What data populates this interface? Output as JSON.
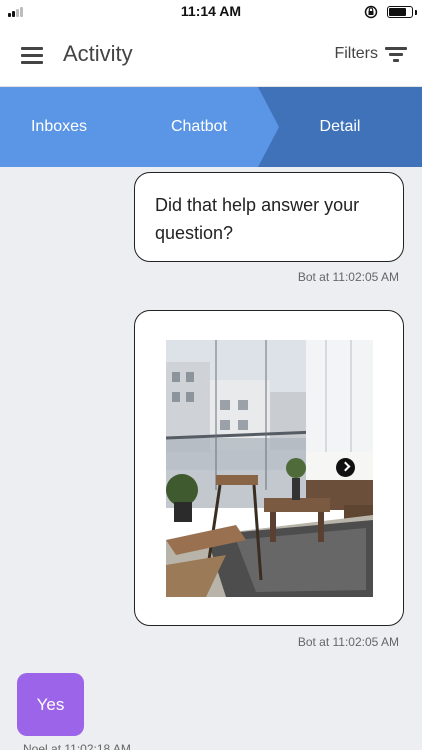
{
  "status_bar": {
    "time": "11:14 AM",
    "icons": [
      "signal-icon",
      "orientation-lock-icon",
      "battery-icon"
    ]
  },
  "header": {
    "title": "Activity",
    "filters_label": "Filters",
    "icons": [
      "menu-icon",
      "filter-icon"
    ]
  },
  "breadcrumb": {
    "items": [
      {
        "label": "Inboxes"
      },
      {
        "label": "Chatbot"
      },
      {
        "label": "Detail",
        "active": true
      }
    ],
    "colors": {
      "inactive": "#5b96e6",
      "active": "#3f72b9"
    }
  },
  "chat": {
    "messages": [
      {
        "sender": "bot",
        "text": "Did that help answer your question?",
        "meta": "Bot at 11:02:05 AM"
      },
      {
        "sender": "bot",
        "type": "image",
        "image_desc": "balcony-with-wicker-furniture",
        "meta": "Bot at 11:02:05 AM"
      },
      {
        "sender": "user",
        "text": "Yes",
        "meta": "Noel at 11:02:18 AM"
      }
    ],
    "user_bubble_color": "#9c64e8"
  }
}
